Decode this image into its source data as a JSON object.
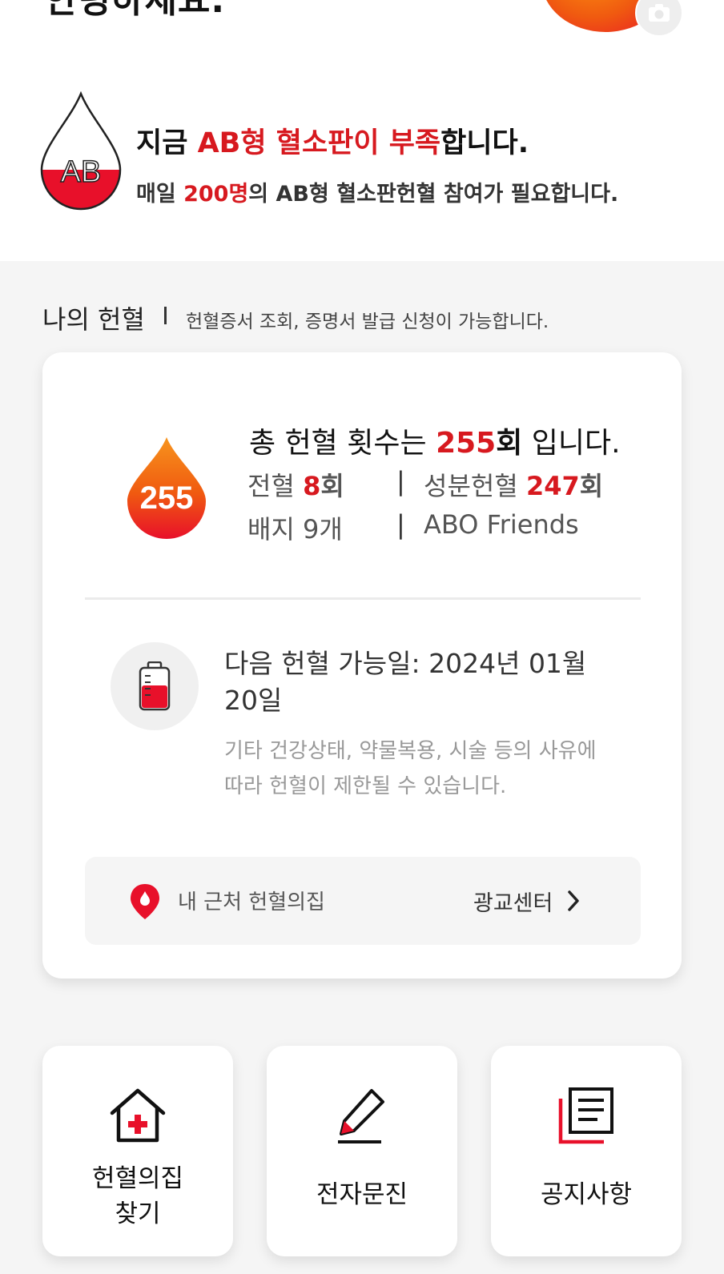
{
  "header": {
    "greeting_partial": "안녕하세요.",
    "camera_icon": "camera-icon"
  },
  "alert": {
    "line1_prefix": "지금 ",
    "line1_highlight": "AB형 혈소판이 부족",
    "line1_suffix": "합니다.",
    "line2_prefix": "매일 ",
    "line2_highlight": "200명",
    "line2_suffix": "의 AB형 혈소판헌혈 참여가 필요합니다.",
    "drop_label": "AB",
    "drop_color": "#e8102a"
  },
  "my_donation": {
    "title": "나의 헌혈",
    "desc": "헌혈증서 조회, 증명서 발급 신청이 가능합니다.",
    "total_prefix": "총 헌혈 횟수는 ",
    "total_count": "255",
    "total_unit": "회",
    "total_suffix": " 입니다.",
    "drop_count": "255",
    "whole_blood_label": "전혈 ",
    "whole_blood_count": "8",
    "whole_blood_unit": "회",
    "component_label": "성분헌혈 ",
    "component_count": "247",
    "component_unit": "회",
    "badges": "배지 9개",
    "club": "ABO Friends",
    "separator": "|",
    "next_date": "다음 헌혈 가능일: 2024년 01월 20일",
    "next_note": "기타 건강상태, 약물복용, 시술 등의 사유에 따라 헌혈이 제한될 수 있습니다.",
    "nearby_label": "내 근처 헌혈의집",
    "nearby_link": "광교센터"
  },
  "tiles": [
    {
      "label": "헌혈의집\n찾기",
      "icon": "house-cross-icon"
    },
    {
      "label": "전자문진",
      "icon": "pen-icon"
    },
    {
      "label": "공지사항",
      "icon": "document-list-icon"
    }
  ],
  "colors": {
    "accent": "#d7191f",
    "orange": "#f5820c",
    "background": "#f5f5f5"
  }
}
